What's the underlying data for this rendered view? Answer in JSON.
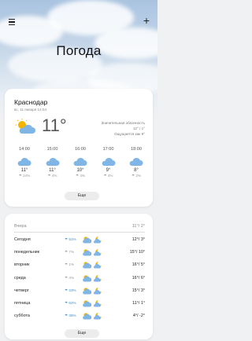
{
  "header": {
    "title": "Погода"
  },
  "current": {
    "city": "Краснодар",
    "date": "вс, 11 января 14:04",
    "temp": "11°",
    "condition": "Значительная облачность",
    "hilo": "12° / 1°",
    "feels_like": "Ощущается как 9°",
    "icon": "partly-cloudy-icon",
    "more_label": "Еще"
  },
  "hourly": [
    {
      "time": "14:00",
      "temp": "11°",
      "precip": "24%",
      "icon": "cloud-icon"
    },
    {
      "time": "15:00",
      "temp": "11°",
      "precip": "4%",
      "icon": "cloud-icon"
    },
    {
      "time": "16:00",
      "temp": "10°",
      "precip": "4%",
      "icon": "cloud-icon"
    },
    {
      "time": "17:00",
      "temp": "9°",
      "precip": "4%",
      "icon": "cloud-icon"
    },
    {
      "time": "18:00",
      "temp": "8°",
      "precip": "2%",
      "icon": "cloud-icon"
    }
  ],
  "daily": {
    "yesterday_label": "Вчера",
    "yesterday_temp": "11°/ 2°",
    "days": [
      {
        "name": "Сегодня",
        "precip": "51%",
        "temp": "12°/ 3°"
      },
      {
        "name": "понедельник",
        "precip": "7%",
        "temp": "15°/ 10°"
      },
      {
        "name": "вторник",
        "precip": "1%",
        "temp": "16°/ 5°"
      },
      {
        "name": "среда",
        "precip": "4%",
        "temp": "16°/ 6°"
      },
      {
        "name": "четверг",
        "precip": "23%",
        "temp": "15°/ 3°"
      },
      {
        "name": "пятница",
        "precip": "62%",
        "temp": "11°/ 1°"
      },
      {
        "name": "суббота",
        "precip": "35%",
        "temp": "4°/ -2°"
      }
    ],
    "more_label": "Еще"
  },
  "colors": {
    "accent": "#3a8fd1",
    "sun": "#f5b400",
    "cloud": "#7fb6e6"
  }
}
